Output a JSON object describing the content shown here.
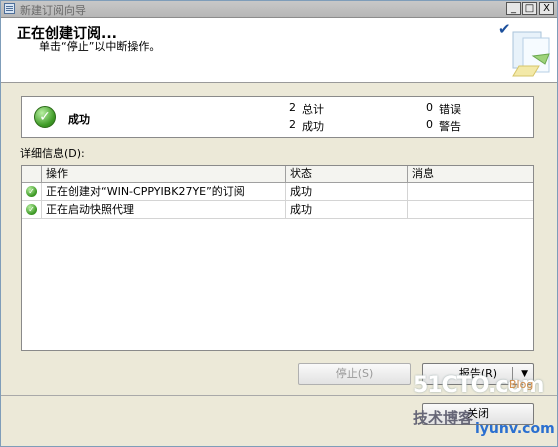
{
  "window": {
    "title": "新建订阅向导"
  },
  "titlebar_buttons": {
    "minimize": "_",
    "maximize": "□",
    "close": "X"
  },
  "header": {
    "title": "正在创建订阅...",
    "subtitle": "单击“停止”以中断操作。"
  },
  "status": {
    "label": "成功",
    "total": {
      "count": "2",
      "label": "总计"
    },
    "success": {
      "count": "2",
      "label": "成功"
    },
    "error": {
      "count": "0",
      "label": "错误"
    },
    "warning": {
      "count": "0",
      "label": "警告"
    }
  },
  "details": {
    "label": "详细信息(D):",
    "columns": [
      "操作",
      "状态",
      "消息"
    ],
    "rows": [
      {
        "action": "正在创建对“WIN-CPPYIBK27YE”的订阅",
        "status": "成功",
        "message": ""
      },
      {
        "action": "正在启动快照代理",
        "status": "成功",
        "message": ""
      }
    ]
  },
  "buttons": {
    "stop": "停止(S)",
    "report": "报告(R)",
    "close": "关闭"
  },
  "watermark": {
    "brand": "51CTO.com",
    "blog": "Blog",
    "cn": "技术博客",
    "site": "iyunv.com"
  },
  "icons": {
    "window_icon": "wizard-window-icon",
    "status_icon": "success-check-icon",
    "row_icon": "success-check-icon"
  },
  "colors": {
    "success": "#3f9b27",
    "accent": "#1c4f9c"
  }
}
